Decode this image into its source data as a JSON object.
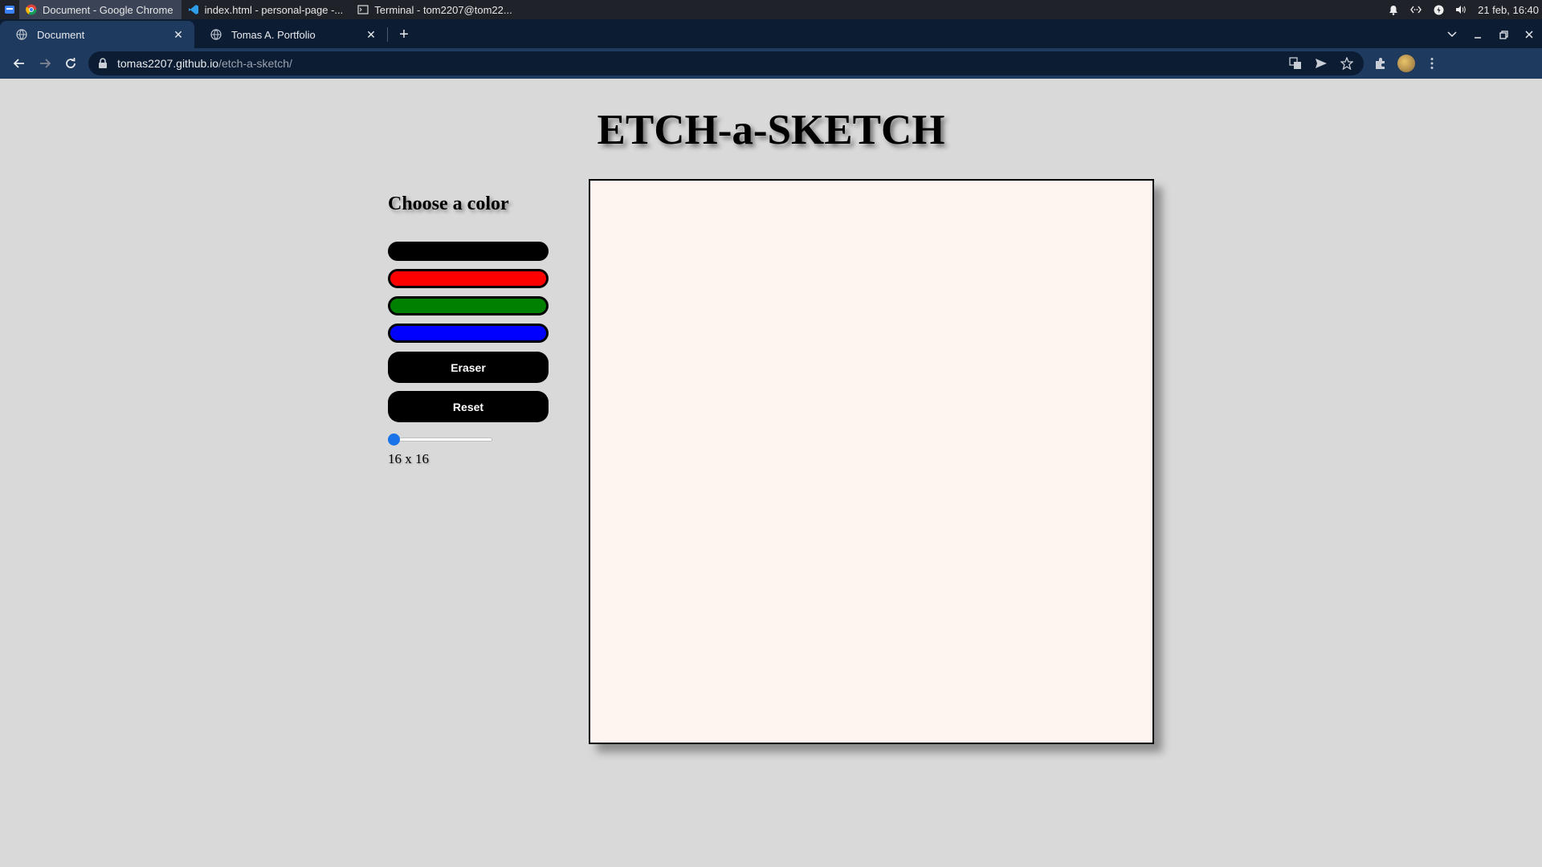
{
  "taskbar": {
    "tasks": [
      {
        "label": "Document - Google Chrome",
        "icon": "chrome-icon",
        "active": true
      },
      {
        "label": "index.html - personal-page -...",
        "icon": "vscode-icon",
        "active": false
      },
      {
        "label": "Terminal - tom2207@tom22...",
        "icon": "terminal-icon",
        "active": false
      }
    ],
    "clock": "21 feb, 16:40"
  },
  "browser": {
    "tabs": [
      {
        "label": "Document",
        "active": true
      },
      {
        "label": "Tomas A. Portfolio",
        "active": false
      }
    ],
    "url_host": "tomas2207.github.io",
    "url_path": "/etch-a-sketch/"
  },
  "page": {
    "title": "ETCH-a-SKETCH",
    "choose_label": "Choose a color",
    "colors": [
      {
        "name": "black",
        "hex": "#000000"
      },
      {
        "name": "red",
        "hex": "#ff0000"
      },
      {
        "name": "green",
        "hex": "#008000"
      },
      {
        "name": "blue",
        "hex": "#0000ff"
      }
    ],
    "eraser_label": "Eraser",
    "reset_label": "Reset",
    "slider": {
      "min": 16,
      "max": 100,
      "value": 16
    },
    "size_label": "16 x 16",
    "canvas_color": "#fff5f0"
  }
}
